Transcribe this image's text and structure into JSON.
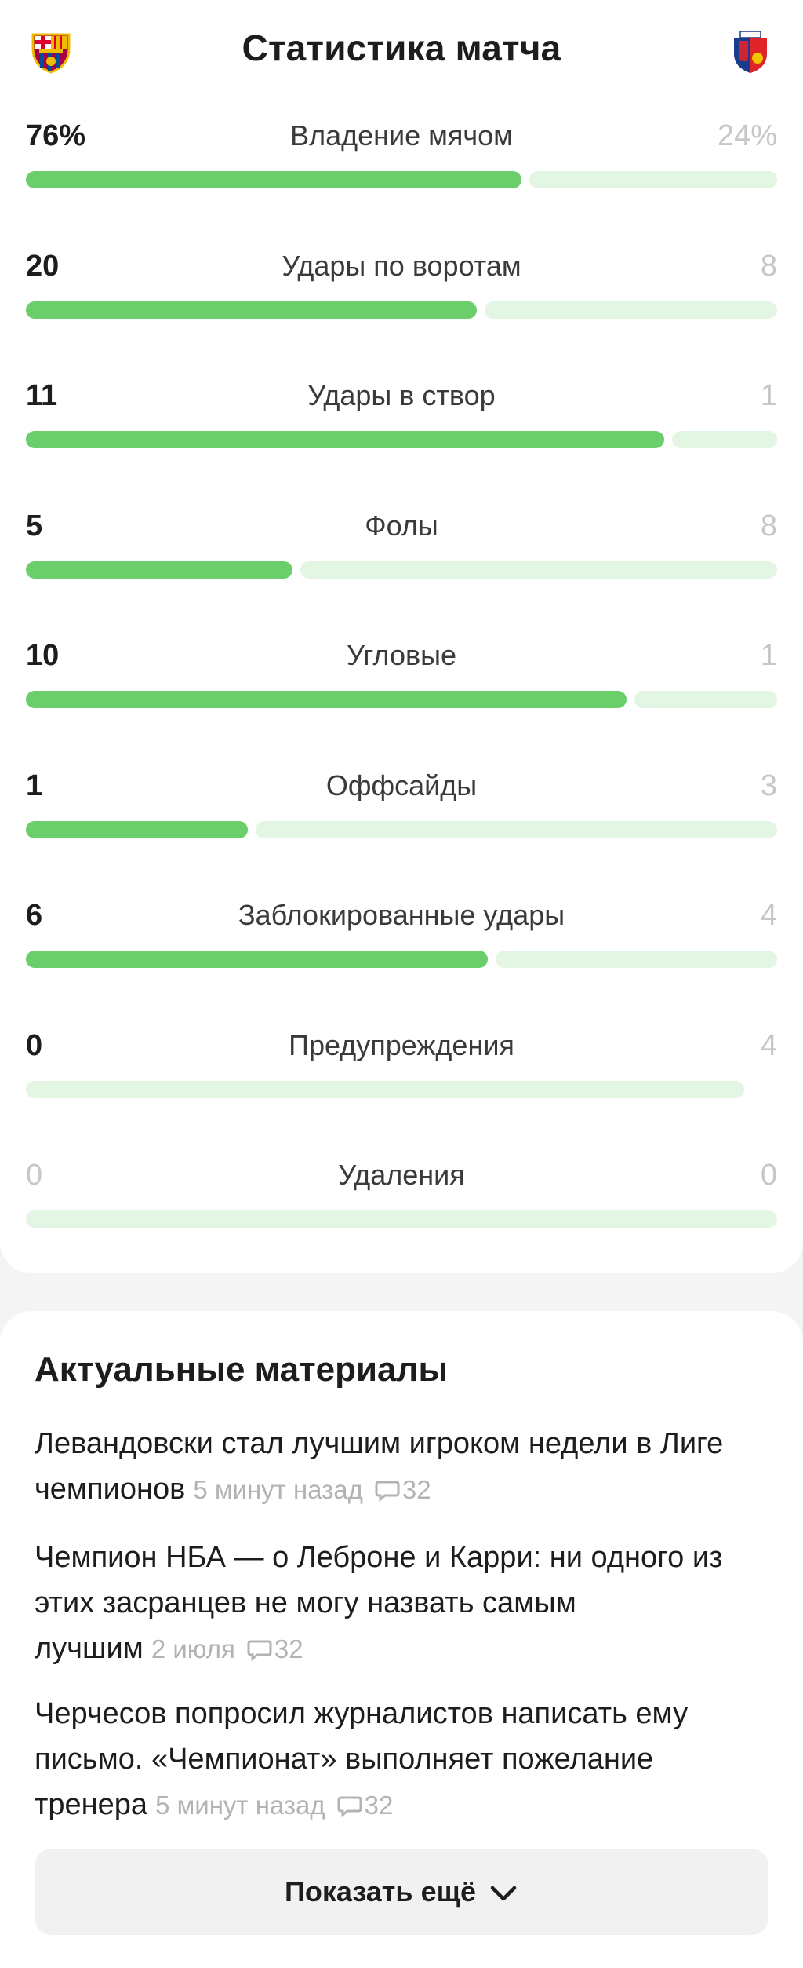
{
  "header": {
    "title": "Статистика матча",
    "home_logo_icon": "fc-barcelona-crest-icon",
    "away_logo_icon": "viktoria-plzen-crest-icon"
  },
  "colors": {
    "bar_home": "#6ace6a",
    "bar_away": "#e3f5e3",
    "muted_text": "#c7c7c7",
    "meta_text": "#b3b3b3"
  },
  "stats": [
    {
      "label": "Владение мячом",
      "home": "76%",
      "away": "24%",
      "home_share": 0.66
    },
    {
      "label": "Удары по воротам",
      "home": "20",
      "away": "8",
      "home_share": 0.6
    },
    {
      "label": "Удары в створ",
      "home": "11",
      "away": "1",
      "home_share": 0.85
    },
    {
      "label": "Фолы",
      "home": "5",
      "away": "8",
      "home_share": 0.355
    },
    {
      "label": "Угловые",
      "home": "10",
      "away": "1",
      "home_share": 0.8
    },
    {
      "label": "Оффсайды",
      "home": "1",
      "away": "3",
      "home_share": 0.295
    },
    {
      "label": "Заблокированные удары",
      "home": "6",
      "away": "4",
      "home_share": 0.615
    },
    {
      "label": "Предупреждения",
      "home": "0",
      "away": "4",
      "home_share": 0
    },
    {
      "label": "Удаления",
      "home": "0",
      "away": "0",
      "home_share": 0
    }
  ],
  "news": {
    "title": "Актуальные материалы",
    "items": [
      {
        "headline": "Левандовски стал лучшим игроком недели в Лиге чемпионов",
        "time": "5 минут назад",
        "comments": "32"
      },
      {
        "headline": "Чемпион НБА — о Леброне и Карри: ни одного из этих засранцев не могу назвать самым лучшим",
        "time": "2 июля",
        "comments": "32"
      },
      {
        "headline": "Черчесов попросил журналистов написать ему письмо. «Чемпионат» выполняет пожелание тренера",
        "time": "5 минут назад",
        "comments": "32"
      }
    ],
    "comment_icon": "speech-bubble-icon",
    "show_more_label": "Показать ещё",
    "show_more_icon": "chevron-down-icon"
  }
}
